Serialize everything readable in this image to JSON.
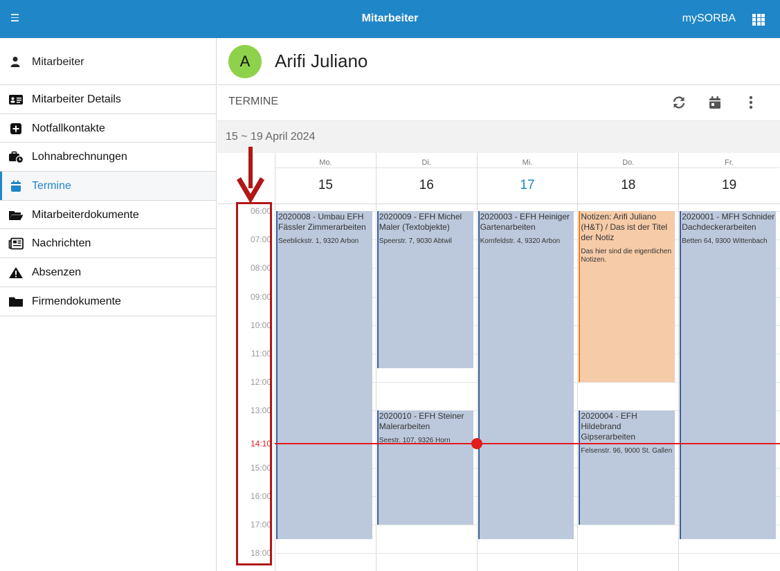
{
  "app": {
    "title": "Mitarbeiter",
    "brand": "mySORBA"
  },
  "sidebar": {
    "header": "Mitarbeiter",
    "items": [
      {
        "label": "Mitarbeiter Details",
        "icon": "id-card-icon"
      },
      {
        "label": "Notfallkontakte",
        "icon": "plus-square-icon"
      },
      {
        "label": "Lohnabrechnungen",
        "icon": "briefcase-clock-icon"
      },
      {
        "label": "Termine",
        "icon": "calendar-icon",
        "active": true
      },
      {
        "label": "Mitarbeiterdokumente",
        "icon": "folder-open-icon"
      },
      {
        "label": "Nachrichten",
        "icon": "newspaper-icon"
      },
      {
        "label": "Absenzen",
        "icon": "warning-icon"
      },
      {
        "label": "Firmendokumente",
        "icon": "folder-icon"
      }
    ]
  },
  "person": {
    "initial": "A",
    "name": "Arifi Juliano",
    "avatar_color": "#8ed14a"
  },
  "section": {
    "label": "TERMINE"
  },
  "range": {
    "label": "15 ~ 19 April 2024"
  },
  "calendar": {
    "days": [
      {
        "name": "Mo.",
        "date": "15"
      },
      {
        "name": "Di.",
        "date": "16"
      },
      {
        "name": "Mi.",
        "date": "17",
        "today": true
      },
      {
        "name": "Do.",
        "date": "18"
      },
      {
        "name": "Fr.",
        "date": "19"
      }
    ],
    "times": [
      "06:00",
      "07:00",
      "08:00",
      "09:00",
      "10:00",
      "11:00",
      "12:00",
      "13:00",
      "15:00",
      "16:00",
      "17:00",
      "18:00"
    ],
    "now": "14:10",
    "events": [
      {
        "day": 0,
        "start": "06:00",
        "end": "17:30",
        "title": "2020008 - Umbau EFH Fässler Zimmerarbeiten",
        "address": "Seeblickstr. 1, 9320 Arbon"
      },
      {
        "day": 1,
        "start": "06:00",
        "end": "11:30",
        "title": "2020009 - EFH Michel Maler (Textobjekte)",
        "address": "Speerstr. 7, 9030 Abtwil"
      },
      {
        "day": 1,
        "start": "13:00",
        "end": "17:00",
        "title": "2020010 - EFH Steiner Malerarbeiten",
        "address": "Seestr. 107, 9326 Horn"
      },
      {
        "day": 2,
        "start": "06:00",
        "end": "17:30",
        "title": "2020003 - EFH Heiniger Gartenarbeiten",
        "address": "Kornfeldstr. 4, 9320 Arbon"
      },
      {
        "day": 3,
        "start": "06:00",
        "end": "12:00",
        "title": "Notizen: Arifi Juliano (H&T) / Das ist der Titel der Notiz",
        "address": "Das hier sind die eigentlichen Notizen.",
        "color": "orange"
      },
      {
        "day": 3,
        "start": "13:00",
        "end": "17:00",
        "title": "2020004 - EFH Hildebrand Gipserarbeiten",
        "address": "Felsenstr. 96, 9000 St. Gallen"
      },
      {
        "day": 4,
        "start": "06:00",
        "end": "17:30",
        "title": "2020001 - MFH Schnider Dachdeckerarbeiten",
        "address": "Betten 64, 9300 Wittenbach"
      }
    ]
  },
  "colors": {
    "accent": "#1f86c8",
    "event": "#bcc9dc",
    "note": "#f6cba8",
    "now": "#e21b1b",
    "annotation": "#b21616"
  }
}
